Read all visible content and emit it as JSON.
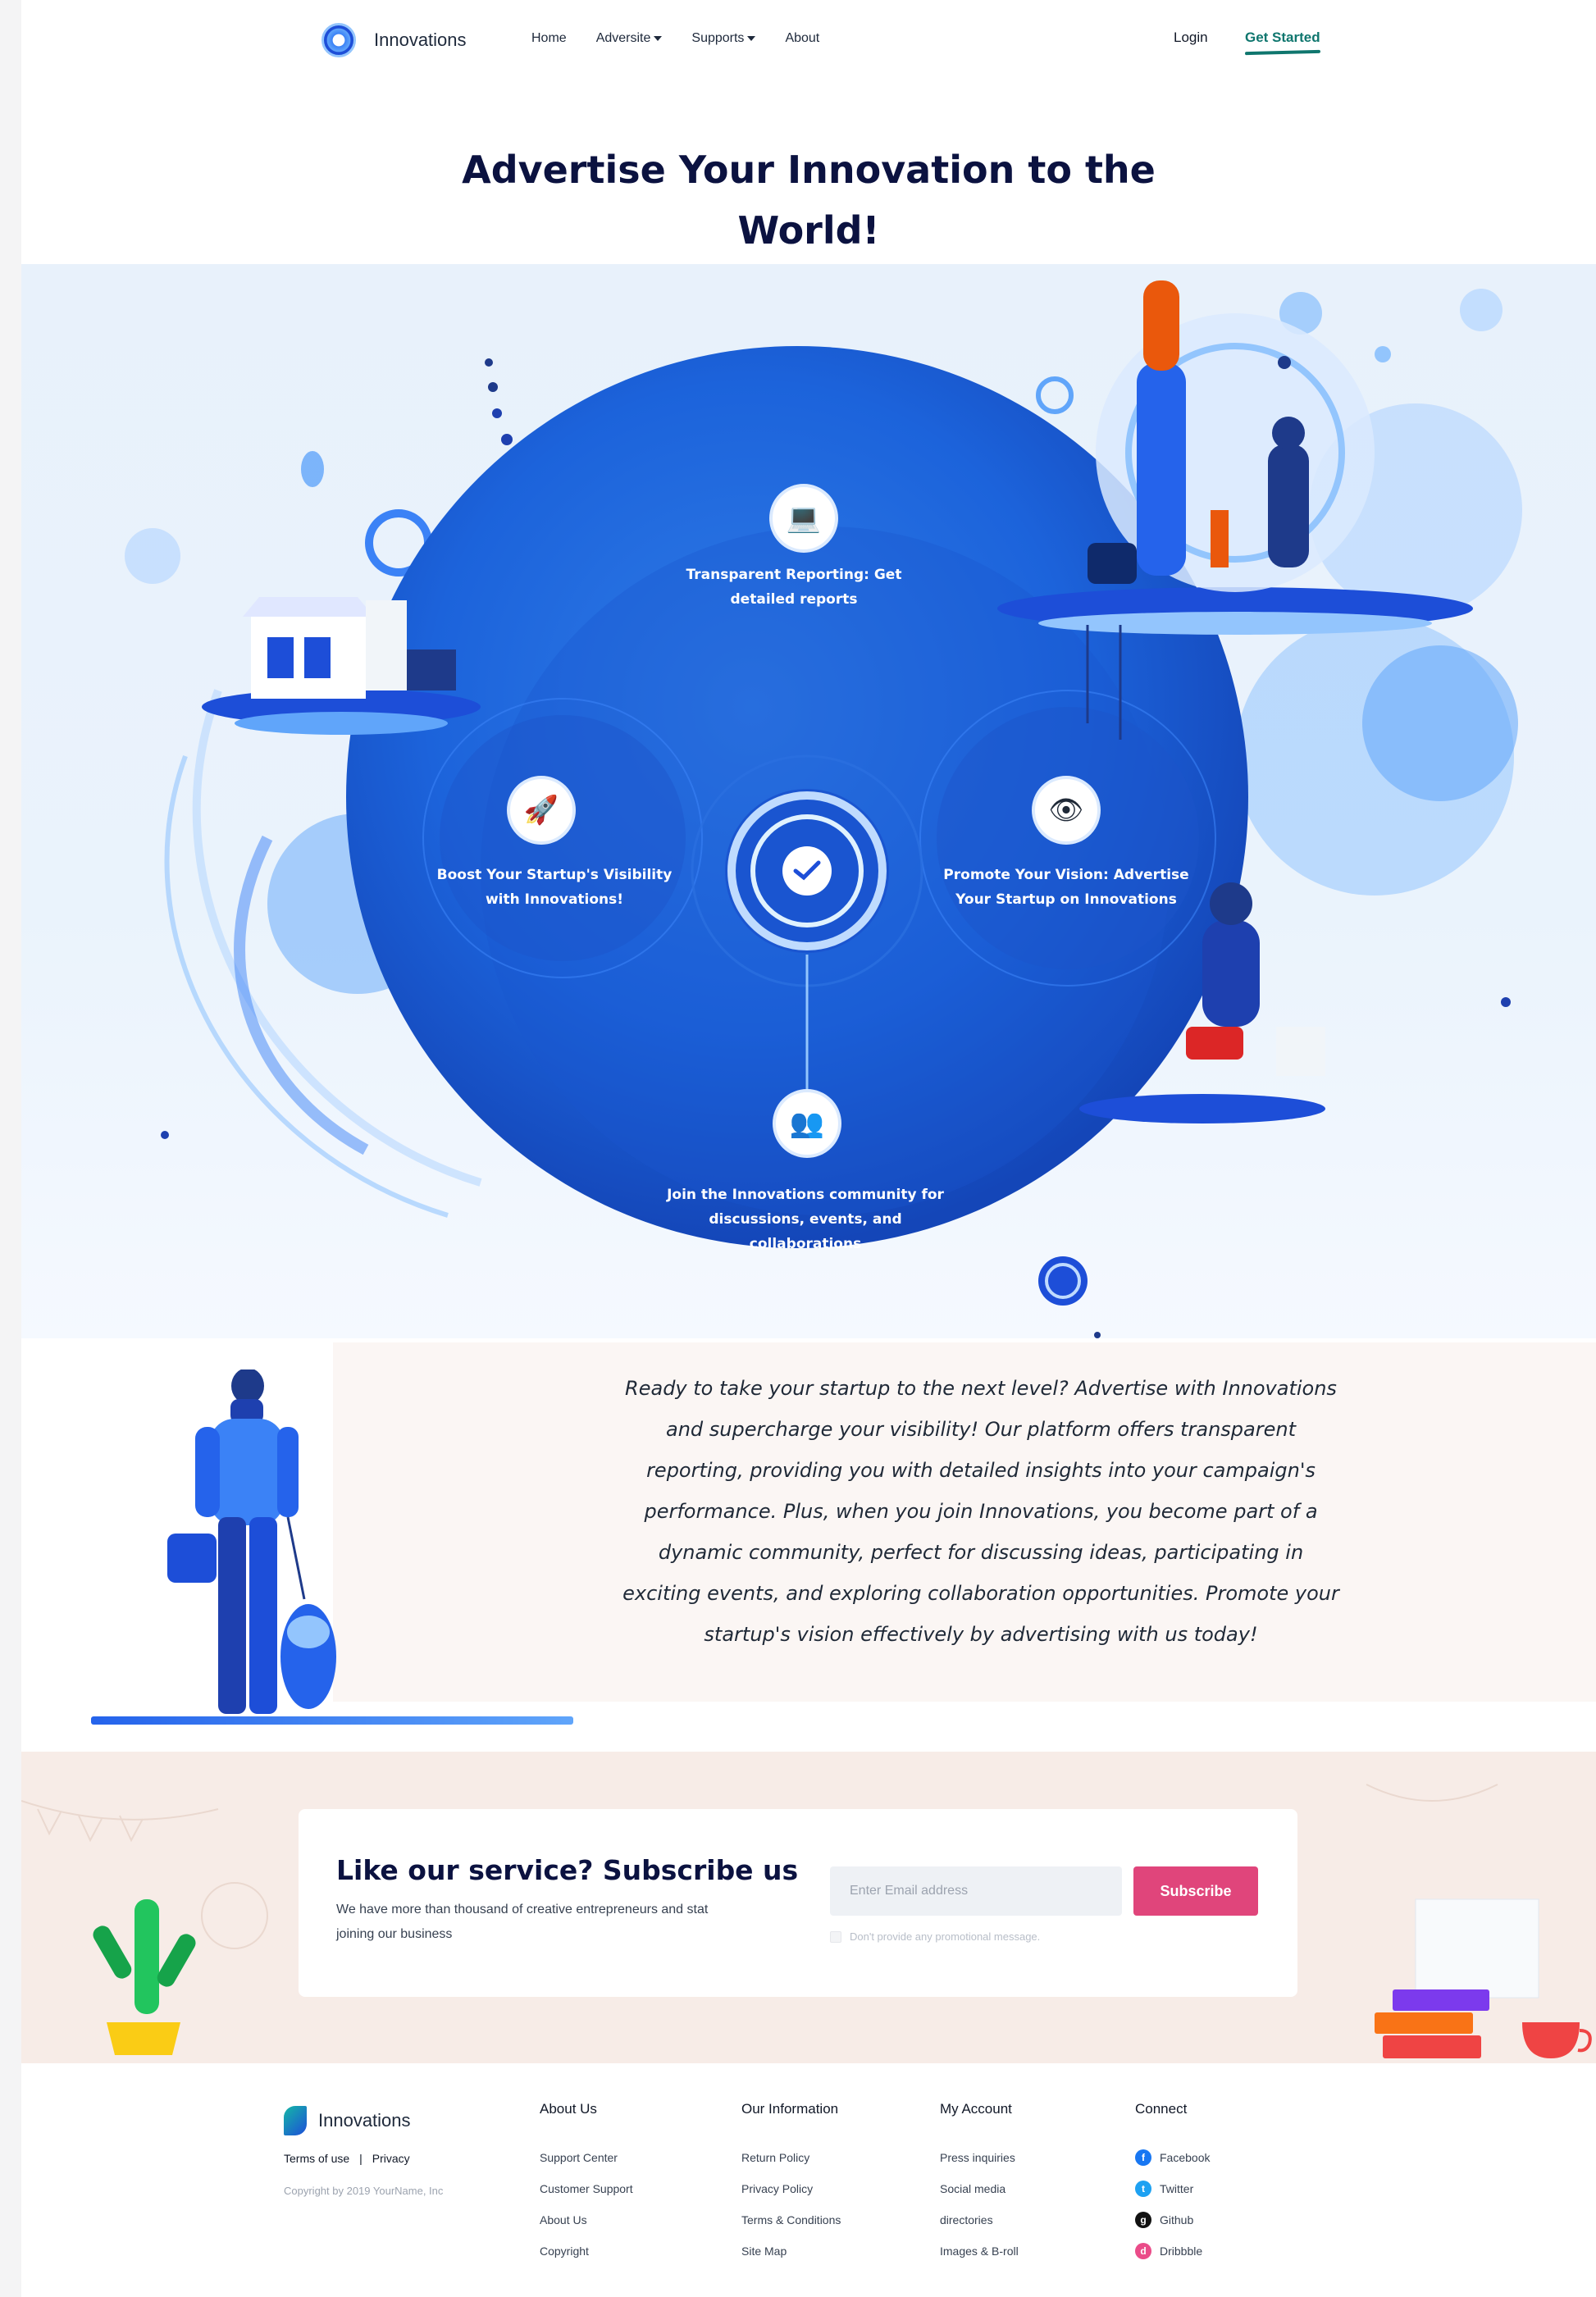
{
  "nav": {
    "brand": "Innovations",
    "items": [
      {
        "label": "Home",
        "dropdown": false
      },
      {
        "label": "Adversite",
        "dropdown": true
      },
      {
        "label": "Supports",
        "dropdown": true
      },
      {
        "label": "About",
        "dropdown": false
      }
    ],
    "login": "Login",
    "get_started": "Get Started"
  },
  "hero": {
    "title_line1": "Advertise Your Innovation to the",
    "title_line2": "World!",
    "features": {
      "reporting": {
        "label": "Transparent Reporting: Get detailed reports",
        "icon": "laptop-chart-icon"
      },
      "visibility": {
        "label": "Boost Your Startup's Visibility with Innovations!",
        "icon": "rocket-icon"
      },
      "vision": {
        "label": "Promote Your Vision: Advertise Your Startup on Innovations",
        "icon": "eye-icon"
      },
      "community": {
        "label": "Join the Innovations community for discussions, events, and collaborations",
        "icon": "community-icon"
      }
    }
  },
  "story": {
    "text": "Ready to take your startup to the next level? Advertise with Innovations and supercharge your visibility! Our platform offers transparent reporting, providing you with detailed insights into your campaign's performance. Plus, when you join Innovations, you become part of a dynamic community, perfect for discussing ideas, participating in exciting events, and exploring collaboration opportunities. Promote your startup's vision effectively by advertising with us today!"
  },
  "subscribe": {
    "title": "Like our service? Subscribe us",
    "description": "We have more than thousand of creative entrepreneurs and stat joining our business",
    "email_placeholder": "Enter Email address",
    "button": "Subscribe",
    "checkbox_label": "Don't provide any promotional message."
  },
  "footer": {
    "brand": "Innovations",
    "terms": "Terms of use",
    "separator": "|",
    "privacy": "Privacy",
    "copyright": "Copyright by 2019 YourName, Inc",
    "columns": [
      {
        "title": "About Us",
        "links": [
          "Support Center",
          "Customer Support",
          "About Us",
          "Copyright"
        ]
      },
      {
        "title": "Our Information",
        "links": [
          "Return Policy",
          "Privacy Policy",
          "Terms & Conditions",
          "Site Map"
        ]
      },
      {
        "title": "My Account",
        "links": [
          "Press inquiries",
          "Social media",
          "directories",
          "Images & B-roll"
        ]
      },
      {
        "title": "Connect",
        "links": [
          "Facebook",
          "Twitter",
          "Github",
          "Dribbble"
        ]
      }
    ],
    "social_icons": [
      "facebook-icon",
      "twitter-icon",
      "github-icon",
      "dribbble-icon"
    ],
    "social_colors": [
      "#1877f2",
      "#1da1f2",
      "#111111",
      "#ea4c89"
    ]
  },
  "colors": {
    "accent_teal": "#0f766e",
    "subscribe_button": "#e0457b",
    "headline": "#0b1240",
    "hero_blue": "#1d5fd8"
  }
}
